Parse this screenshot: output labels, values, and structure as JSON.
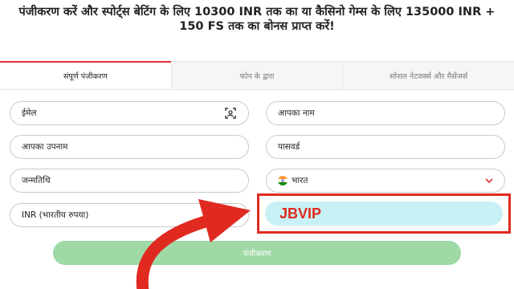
{
  "headline": "पंजीकरण करें और स्पोर्ट्स बेटिंग के लिए 10300 INR तक का या कैसिनो गेम्स के लिए 135000 INR + 150 FS तक का बोनस प्राप्त करें!",
  "tabs": [
    {
      "label": "संपूर्ण पंजीकरण",
      "active": true
    },
    {
      "label": "फोन के द्वारा",
      "active": false
    },
    {
      "label": "सोशल नेटवर्क्स और मैसेंजर्स",
      "active": false
    }
  ],
  "form": {
    "email_label": "ईमेल",
    "name_label": "आपका नाम",
    "surname_label": "आपका उपनाम",
    "password_label": "पासवर्ड",
    "dob_label": "जन्मतिथि",
    "country_value": "भारत",
    "currency_value": "INR (भारतीय रुपया)",
    "promo_value": "JBVIP",
    "submit_label": "पंजीकरण"
  },
  "icons": {
    "email_scan": "scan-icon",
    "country_dropdown": "chevron-down-icon",
    "country_flag": "india-flag-icon"
  },
  "colors": {
    "accent_red": "#e0303a",
    "highlight_border": "#e02a20",
    "promo_bg": "#c8f1f5",
    "submit_bg": "#9fd9a6"
  }
}
